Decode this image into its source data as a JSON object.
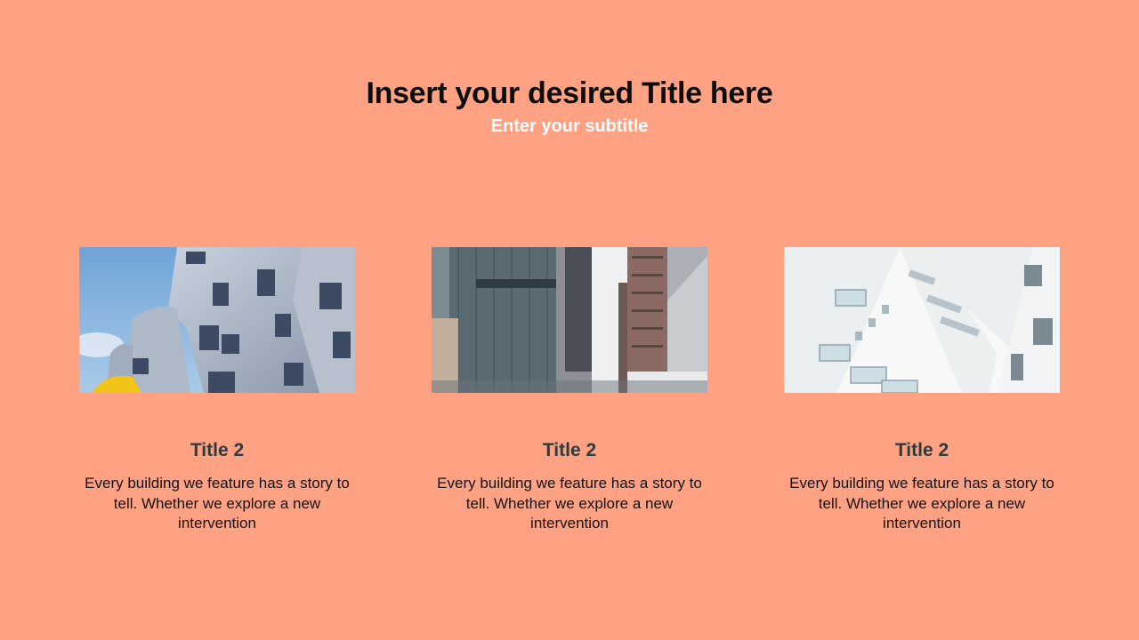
{
  "slide": {
    "title": "Insert your desired Title here",
    "subtitle": "Enter your subtitle",
    "background_color": "#FFA284"
  },
  "cards": [
    {
      "title": "Title 2",
      "text": "Every building we feature has a story to tell.  Whether we explore a new intervention",
      "image": "building-photo-curved-facade"
    },
    {
      "title": "Title 2",
      "text": "Every building we feature has a story to tell.  Whether we explore a new intervention",
      "image": "building-photo-skyscrapers"
    },
    {
      "title": "Title 2",
      "text": "Every building we feature has a story to tell.  Whether we explore a new intervention",
      "image": "building-photo-white-tower"
    }
  ]
}
